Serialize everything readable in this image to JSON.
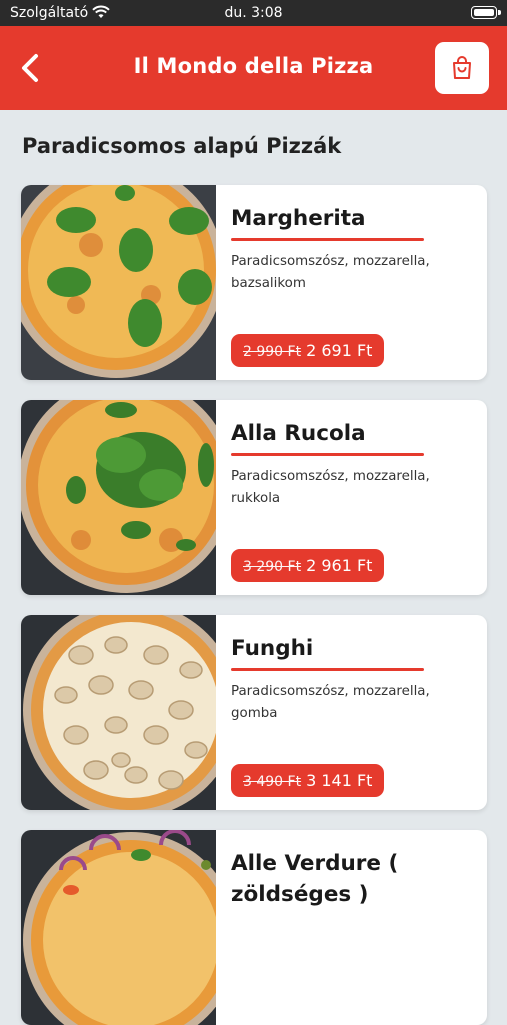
{
  "status_bar": {
    "carrier": "Szolgáltató",
    "time": "du. 3:08"
  },
  "header": {
    "title": "Il Mondo della Pizza",
    "back_icon": "chevron-left-icon",
    "cart_icon": "shopping-bag-icon"
  },
  "section": {
    "title": "Paradicsomos alapú Pizzák"
  },
  "pizzas": [
    {
      "name": "Margherita",
      "description": "Paradicsomszósz, mozzarella, bazsalikom",
      "old_price": "2 990 Ft",
      "price": "2 691 Ft"
    },
    {
      "name": "Alla Rucola",
      "description": "Paradicsomszósz, mozzarella, rukkola",
      "old_price": "3 290 Ft",
      "price": "2 961 Ft"
    },
    {
      "name": "Funghi",
      "description": "Paradicsomszósz, mozzarella, gomba",
      "old_price": "3 490 Ft",
      "price": "3 141 Ft"
    },
    {
      "name": "Alle Verdure ( zöldséges )",
      "description": "",
      "old_price": "",
      "price": ""
    }
  ],
  "colors": {
    "accent": "#e53a2d",
    "background": "#e3e8eb",
    "status_bar": "#2b2b2b"
  }
}
